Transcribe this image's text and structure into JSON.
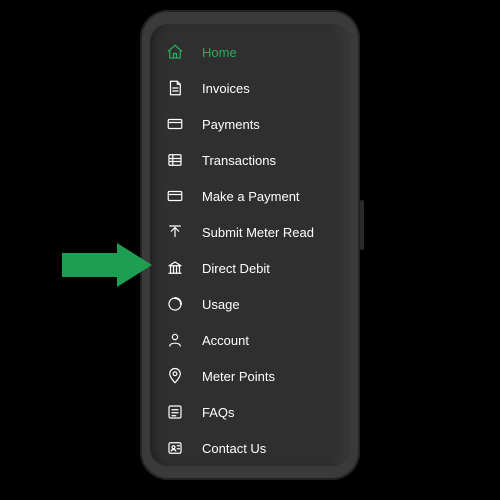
{
  "colors": {
    "accent": "#27ae60",
    "phone_body": "#3a3a3a",
    "screen_bg": "#2f2f2f",
    "text": "#ffffff",
    "arrow": "#1e9e52"
  },
  "arrow_target": "direct-debit",
  "menu": {
    "items": [
      {
        "id": "home",
        "label": "Home",
        "icon": "home-icon",
        "active": true
      },
      {
        "id": "invoices",
        "label": "Invoices",
        "icon": "document-icon",
        "active": false
      },
      {
        "id": "payments",
        "label": "Payments",
        "icon": "card-icon",
        "active": false
      },
      {
        "id": "transactions",
        "label": "Transactions",
        "icon": "list-icon",
        "active": false
      },
      {
        "id": "make-payment",
        "label": "Make a Payment",
        "icon": "card-icon",
        "active": false
      },
      {
        "id": "submit-read",
        "label": "Submit Meter Read",
        "icon": "upload-icon",
        "active": false
      },
      {
        "id": "direct-debit",
        "label": "Direct Debit",
        "icon": "bank-icon",
        "active": false
      },
      {
        "id": "usage",
        "label": "Usage",
        "icon": "progress-icon",
        "active": false
      },
      {
        "id": "account",
        "label": "Account",
        "icon": "person-icon",
        "active": false
      },
      {
        "id": "meter-points",
        "label": "Meter Points",
        "icon": "pin-icon",
        "active": false
      },
      {
        "id": "faqs",
        "label": "FAQs",
        "icon": "faq-icon",
        "active": false
      },
      {
        "id": "contact",
        "label": "Contact Us",
        "icon": "contact-icon",
        "active": false
      }
    ]
  }
}
